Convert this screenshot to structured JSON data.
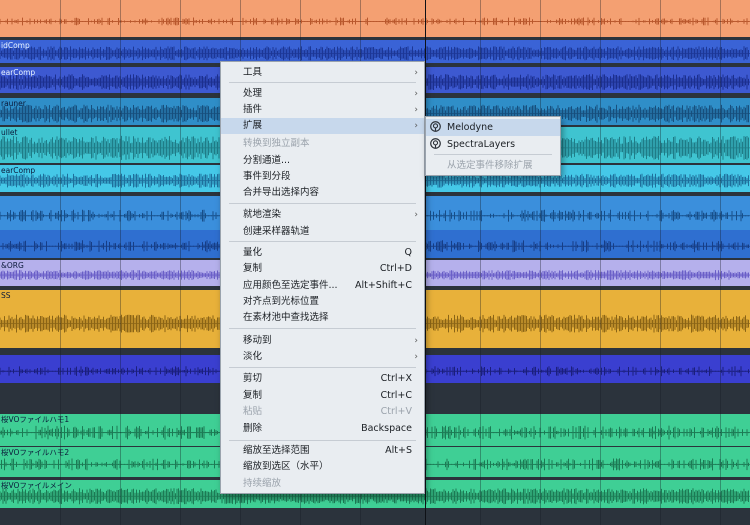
{
  "tracks": [
    {
      "name": "",
      "color": "#f4a072",
      "wave": "#b8572c"
    },
    {
      "name": "idComp",
      "color": "#3a63d6",
      "wave": "#1c3796"
    },
    {
      "name": "earComp",
      "color": "#3d59d1",
      "wave": "#1c2f8e"
    },
    {
      "name": "rauner",
      "color": "#2f8ec8",
      "wave": "#174f7d"
    },
    {
      "name": "ullet",
      "color": "#3fc4d0",
      "wave": "#1f7c87"
    },
    {
      "name": "earComp",
      "color": "#45c8e8",
      "wave": "#1e6f9c"
    },
    {
      "name": "",
      "color": "#3b8fdc",
      "wave": "#174e89"
    },
    {
      "name": "",
      "color": "#2f6fd0",
      "wave": "#173e86"
    },
    {
      "name": "&ORG",
      "color": "#b5b0ec",
      "wave": "#6a5fc8"
    },
    {
      "name": "SS",
      "color": "#e8b13a",
      "wave": "#8a6416"
    },
    {
      "name": "",
      "color": "#3a3fd0",
      "wave": "#1b1f7c"
    },
    {
      "name": "桜VOファイルハモ1",
      "color": "#3fcf95",
      "wave": "#1c7a54"
    },
    {
      "name": "桜VOファイルハモ2",
      "color": "#3fcf95",
      "wave": "#1c7a54"
    },
    {
      "name": "桜VOファイルメイン",
      "color": "#3fcf95",
      "wave": "#1c7a54"
    }
  ],
  "context_menu": {
    "items": [
      {
        "label": "工具",
        "shortcut": "",
        "submenu": true,
        "disabled": false
      },
      {
        "label": "处理",
        "shortcut": "",
        "submenu": true,
        "disabled": false
      },
      {
        "label": "插件",
        "shortcut": "",
        "submenu": true,
        "disabled": false
      },
      {
        "label": "扩展",
        "shortcut": "",
        "submenu": true,
        "disabled": false,
        "highlighted": true
      },
      {
        "label": "转换到独立副本",
        "shortcut": "",
        "submenu": false,
        "disabled": true
      },
      {
        "label": "分割通道...",
        "shortcut": "",
        "submenu": false,
        "disabled": false
      },
      {
        "label": "事件到分段",
        "shortcut": "",
        "submenu": false,
        "disabled": false
      },
      {
        "label": "合并导出选择内容",
        "shortcut": "",
        "submenu": false,
        "disabled": false
      },
      {
        "label": "就地渲染",
        "shortcut": "",
        "submenu": true,
        "disabled": false
      },
      {
        "label": "创建采样器轨道",
        "shortcut": "",
        "submenu": false,
        "disabled": false
      },
      {
        "label": "量化",
        "shortcut": "Q",
        "submenu": false,
        "disabled": false
      },
      {
        "label": "复制",
        "shortcut": "Ctrl+D",
        "submenu": false,
        "disabled": false
      },
      {
        "label": "应用颜色至选定事件...",
        "shortcut": "Alt+Shift+C",
        "submenu": false,
        "disabled": false
      },
      {
        "label": "对齐点到光标位置",
        "shortcut": "",
        "submenu": false,
        "disabled": false
      },
      {
        "label": "在素材池中查找选择",
        "shortcut": "",
        "submenu": false,
        "disabled": false
      },
      {
        "label": "移动到",
        "shortcut": "",
        "submenu": true,
        "disabled": false
      },
      {
        "label": "淡化",
        "shortcut": "",
        "submenu": true,
        "disabled": false
      },
      {
        "label": "剪切",
        "shortcut": "Ctrl+X",
        "submenu": false,
        "disabled": false
      },
      {
        "label": "复制",
        "shortcut": "Ctrl+C",
        "submenu": false,
        "disabled": false
      },
      {
        "label": "粘贴",
        "shortcut": "Ctrl+V",
        "submenu": false,
        "disabled": true
      },
      {
        "label": "删除",
        "shortcut": "Backspace",
        "submenu": false,
        "disabled": false
      },
      {
        "label": "缩放至选择范围",
        "shortcut": "Alt+S",
        "submenu": false,
        "disabled": false
      },
      {
        "label": "缩放到选区（水平）",
        "shortcut": "",
        "submenu": false,
        "disabled": false
      },
      {
        "label": "持续缩放",
        "shortcut": "",
        "submenu": false,
        "disabled": true
      }
    ],
    "submenu_arrow": "›"
  },
  "extension_submenu": {
    "items": [
      {
        "label": "Melodyne",
        "icon": "melodyne-icon",
        "highlighted": true,
        "disabled": false
      },
      {
        "label": "SpectraLayers",
        "icon": "spectralayers-icon",
        "highlighted": false,
        "disabled": false
      },
      {
        "label": "从选定事件移除扩展",
        "icon": "",
        "highlighted": false,
        "disabled": true
      }
    ]
  }
}
